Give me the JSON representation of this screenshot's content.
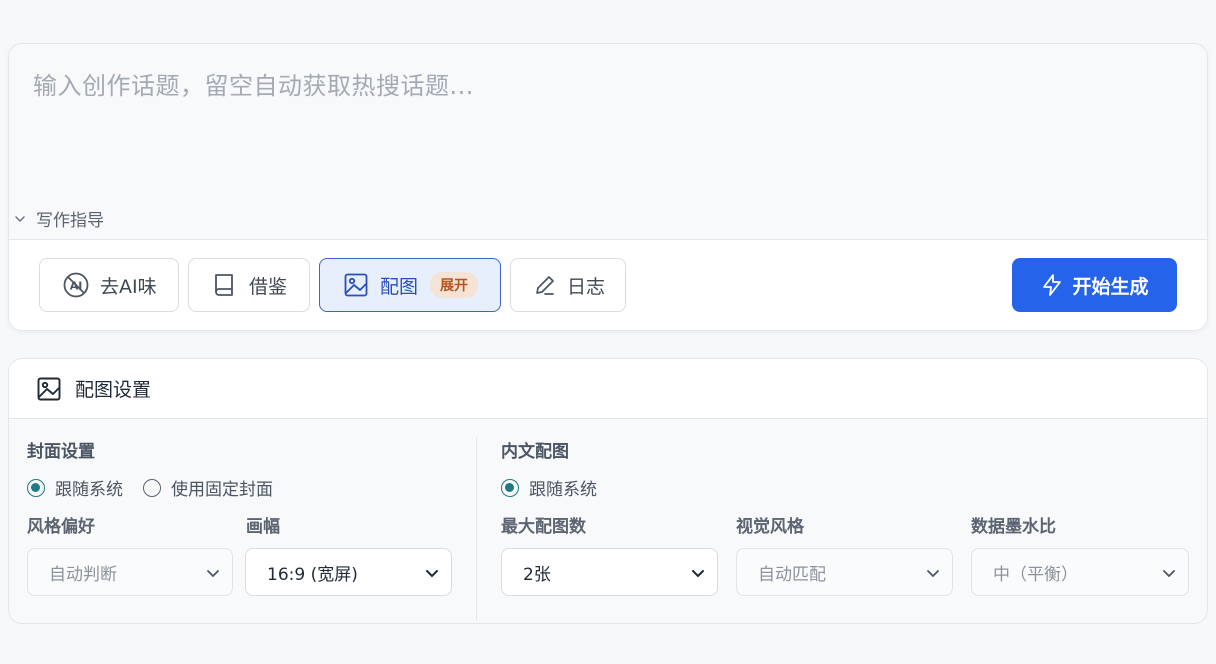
{
  "composer": {
    "topic_placeholder": "输入创作话题，留空自动获取热搜话题...",
    "guide_label": "写作指导"
  },
  "toolbar": {
    "buttons": [
      {
        "label": "去AI味",
        "icon": "no-ai-icon"
      },
      {
        "label": "借鉴",
        "icon": "book-icon"
      },
      {
        "label": "配图",
        "icon": "image-icon",
        "badge": "展开",
        "active": true
      },
      {
        "label": "日志",
        "icon": "pen-icon"
      }
    ],
    "start_label": "开始生成",
    "accent": "#2563eb"
  },
  "image_settings": {
    "title": "配图设置",
    "cover": {
      "title": "封面设置",
      "options": [
        "跟随系统",
        "使用固定封面"
      ],
      "selected": "跟随系统",
      "style_label": "风格偏好",
      "style_value": "自动判断",
      "ratio_label": "画幅",
      "ratio_value": "16:9 (宽屏)"
    },
    "inline": {
      "title": "内文配图",
      "option": "跟随系统",
      "max_label": "最大配图数",
      "max_value": "2张",
      "visual_label": "视觉风格",
      "visual_value": "自动匹配",
      "ink_label": "数据墨水比",
      "ink_value": "中（平衡）"
    },
    "radio_color": "#1f7a86"
  }
}
